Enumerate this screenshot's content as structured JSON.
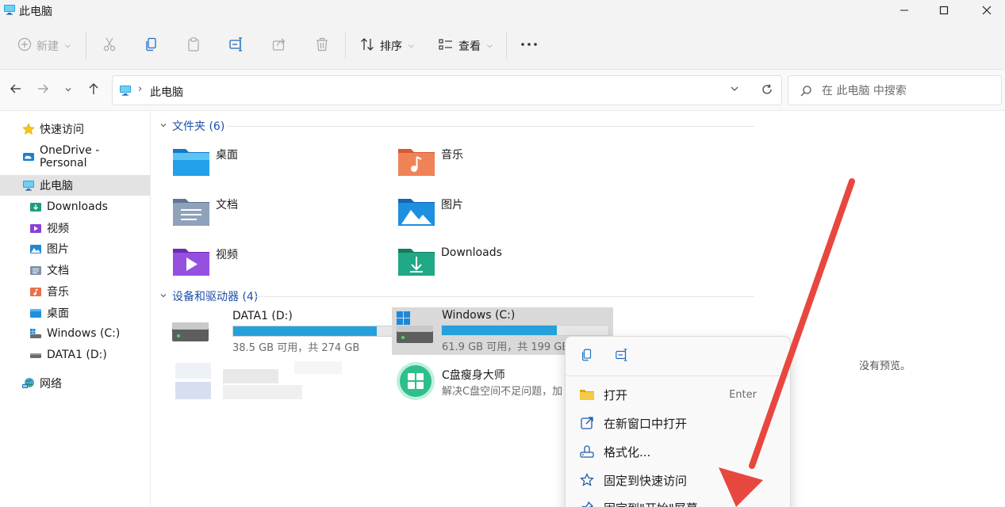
{
  "window": {
    "title": "此电脑",
    "controls": [
      "minimize",
      "maximize",
      "close"
    ]
  },
  "toolbar": {
    "new_label": "新建",
    "sort_label": "排序",
    "view_label": "查看",
    "icons": [
      "cut-icon",
      "copy-icon",
      "paste-icon",
      "rename-icon",
      "share-icon",
      "delete-icon",
      "more-icon"
    ]
  },
  "navbar": {
    "breadcrumb": "此电脑",
    "search_placeholder": "在 此电脑 中搜索"
  },
  "sidebar": {
    "items": [
      {
        "label": "快速访问",
        "icon": "star-icon"
      },
      {
        "label": "OneDrive - Personal",
        "icon": "cloud-icon"
      },
      {
        "label": "此电脑",
        "icon": "computer-icon",
        "selected": true
      },
      {
        "label": "Downloads",
        "icon": "downloads-icon"
      },
      {
        "label": "视频",
        "icon": "videos-icon"
      },
      {
        "label": "图片",
        "icon": "pictures-icon"
      },
      {
        "label": "文档",
        "icon": "documents-icon"
      },
      {
        "label": "音乐",
        "icon": "music-icon"
      },
      {
        "label": "桌面",
        "icon": "desktop-icon"
      },
      {
        "label": "Windows (C:)",
        "icon": "drive-icon"
      },
      {
        "label": "DATA1 (D:)",
        "icon": "drive-icon"
      },
      {
        "label": "网络",
        "icon": "network-icon"
      }
    ]
  },
  "folders_group": {
    "label": "文件夹 (6)",
    "items": [
      {
        "label": "桌面",
        "icon": "desktop-folder-icon"
      },
      {
        "label": "音乐",
        "icon": "music-folder-icon"
      },
      {
        "label": "文档",
        "icon": "documents-folder-icon"
      },
      {
        "label": "图片",
        "icon": "pictures-folder-icon"
      },
      {
        "label": "视频",
        "icon": "videos-folder-icon"
      },
      {
        "label": "Downloads",
        "icon": "downloads-folder-icon"
      }
    ]
  },
  "drives_group": {
    "label": "设备和驱动器 (4)",
    "drives": [
      {
        "name": "DATA1 (D:)",
        "size_text": "38.5 GB 可用，共 274 GB",
        "used_fraction": 0.86
      },
      {
        "name": "Windows (C:)",
        "size_text": "61.9 GB 可用，共 199 GB",
        "used_fraction": 0.69,
        "selected": true
      }
    ],
    "app": {
      "name": "C盘瘦身大师",
      "desc": "解决C盘空间不足问题，加"
    }
  },
  "preview": {
    "empty_text": "没有预览。"
  },
  "context_menu": {
    "quick_icons": [
      "copy-icon",
      "rename-icon"
    ],
    "items": [
      {
        "label": "打开",
        "shortcut": "Enter",
        "icon": "folder-open-icon"
      },
      {
        "label": "在新窗口中打开",
        "icon": "new-window-icon"
      },
      {
        "label": "格式化...",
        "icon": "format-icon"
      },
      {
        "label": "固定到快速访问",
        "icon": "star-outline-icon"
      },
      {
        "label": "固定到\"开始\"屏幕",
        "icon": "pin-icon"
      }
    ]
  },
  "annotation": {
    "arrow_color": "#e8473f"
  }
}
